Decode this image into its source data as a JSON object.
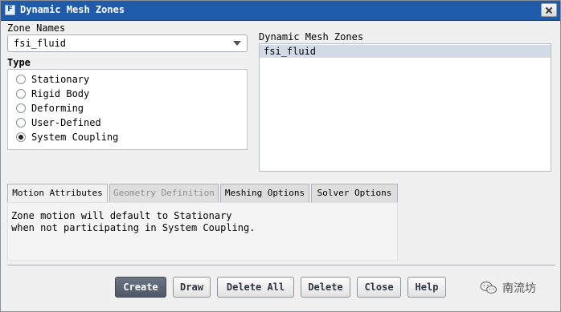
{
  "window": {
    "title": "Dynamic Mesh Zones",
    "icon_letter": "F"
  },
  "zone_names": {
    "label": "Zone Names",
    "value": "fsi_fluid"
  },
  "type": {
    "label": "Type",
    "options": [
      "Stationary",
      "Rigid Body",
      "Deforming",
      "User-Defined",
      "System Coupling"
    ],
    "selected": "System Coupling"
  },
  "dynamic_mesh_zones": {
    "label": "Dynamic Mesh Zones",
    "items": [
      "fsi_fluid"
    ]
  },
  "tabs": [
    {
      "label": "Motion Attributes",
      "active": true,
      "enabled": true
    },
    {
      "label": "Geometry Definition",
      "active": false,
      "enabled": false
    },
    {
      "label": "Meshing Options",
      "active": false,
      "enabled": true
    },
    {
      "label": "Solver Options",
      "active": false,
      "enabled": true
    }
  ],
  "motion_attributes": {
    "lines": [
      "Zone motion will default to Stationary",
      "when not participating in System Coupling."
    ]
  },
  "buttons": {
    "create": "Create",
    "draw": "Draw",
    "delete_all": "Delete All",
    "delete": "Delete",
    "close": "Close",
    "help": "Help"
  },
  "watermark": {
    "text": "南流坊"
  },
  "colors": {
    "title_bar": "#1f5ba9",
    "selection": "#d2dbe6",
    "primary_button": "#5a6473"
  },
  "icons": {
    "close": "close-icon",
    "dropdown": "chevron-down-icon",
    "app": "fluent-app-icon"
  }
}
